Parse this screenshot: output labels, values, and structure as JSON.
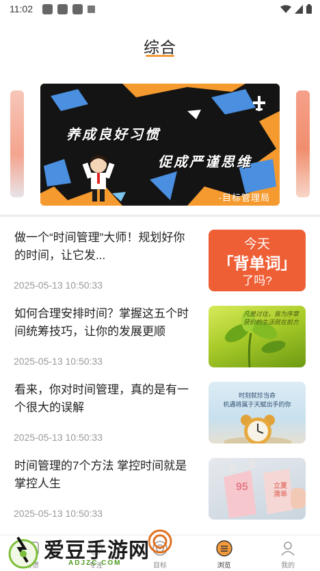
{
  "status_bar": {
    "time": "11:02",
    "icons": [
      "app-notification-icon",
      "app-notification-icon",
      "app-notification-icon",
      "small-a-notification-icon",
      "wifi-icon",
      "cell-signal-icon",
      "battery-icon"
    ]
  },
  "header": {
    "title": "综合",
    "accent_color": "#f39a3c"
  },
  "banner": {
    "line1": "养成良好习惯",
    "line2": "促成严谨思维",
    "caption": "-目标管理局"
  },
  "articles": [
    {
      "title": "做一个“时间管理”大师！规划好你的时间，让它发...",
      "date": "2025-05-13 10:50:33",
      "thumb": {
        "line1": "今天",
        "line2": "「背单词」",
        "line3": "了吗?"
      }
    },
    {
      "title": "如何合理安排时间？掌握这五个时间统筹技巧，让你的发展更顺",
      "date": "2025-05-13 10:50:33",
      "thumb": {
        "line1": "凡是过往，皆为序章",
        "line2": "获价的生活就在前方"
      }
    },
    {
      "title": "看来，你对时间管理，真的是有一个很大的误解",
      "date": "2025-05-13 10:50:33",
      "thumb": {
        "line1": "时刻就珍当命",
        "line2": "机遇将属于天赋出手的你"
      }
    },
    {
      "title": "时间管理的7个方法 掌控时间就是掌控人生",
      "date": "2025-05-13 10:50:33",
      "thumb": {
        "line1": "95",
        "line2": "立夏 清单"
      }
    }
  ],
  "bottom_nav": [
    {
      "label": "习惯",
      "icon": "habit-icon"
    },
    {
      "label": "专注",
      "icon": "focus-icon"
    },
    {
      "label": "目标",
      "icon": "target-icon"
    },
    {
      "label": "浏览",
      "icon": "browse-icon",
      "active": true
    },
    {
      "label": "我的",
      "icon": "profile-icon"
    }
  ],
  "watermark": {
    "brand": "爱豆手游网",
    "url": "ADJZC.COM"
  },
  "colors": {
    "accent": "#f39a3c",
    "thumb_orange": "#ee5f36",
    "date_gray": "#9a9a9a"
  }
}
